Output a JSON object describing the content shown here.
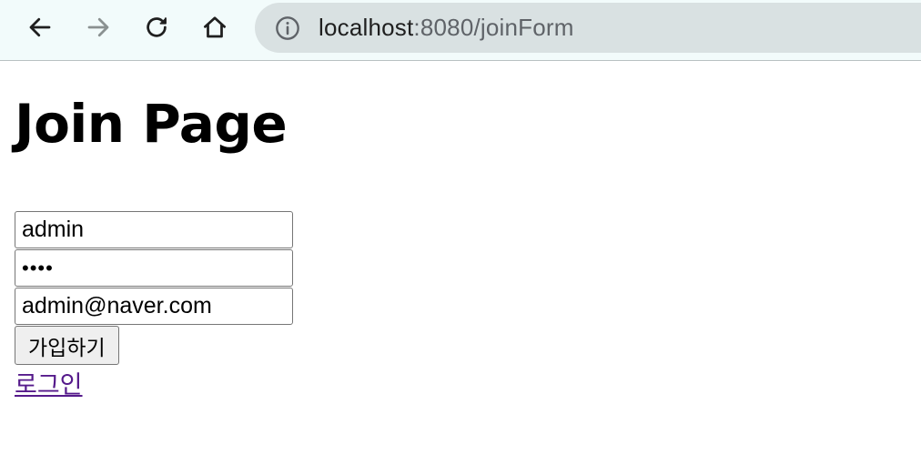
{
  "browser": {
    "url_host": "localhost",
    "url_path": ":8080/joinForm"
  },
  "page": {
    "title": "Join Page"
  },
  "form": {
    "username_value": "admin",
    "password_value": "1234",
    "email_value": "admin@naver.com",
    "submit_label": "가입하기"
  },
  "links": {
    "login_label": "로그인"
  },
  "colors": {
    "toolbar_bg": "#f2fbfb",
    "omnibox_bg": "#d9e1e2",
    "visited_link": "#551a8b"
  },
  "icons": {
    "back": "arrow-left-icon",
    "forward": "arrow-right-icon",
    "reload": "reload-icon",
    "home": "home-icon",
    "site_info": "info-icon"
  }
}
